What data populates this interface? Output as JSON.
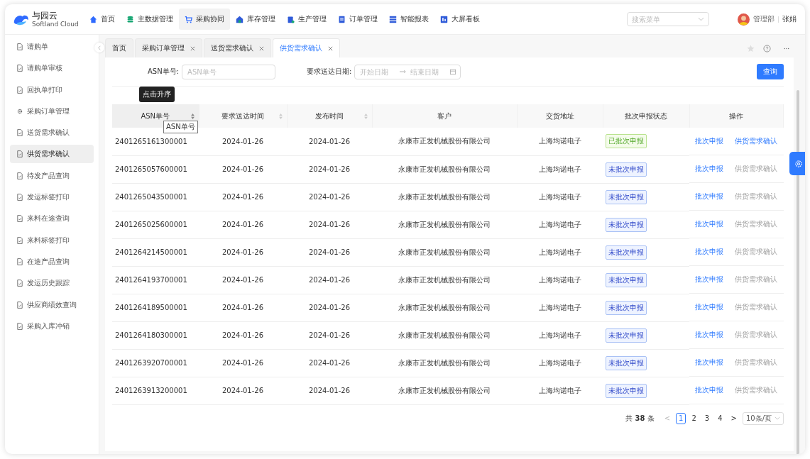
{
  "logo": {
    "name": "与园云",
    "subtitle": "Softland Cloud"
  },
  "nav": [
    {
      "label": "首页",
      "kind": "home",
      "selected": false
    },
    {
      "label": "主数据管理",
      "kind": "db",
      "selected": false
    },
    {
      "label": "采购协同",
      "kind": "cart",
      "selected": true
    },
    {
      "label": "库存管理",
      "kind": "store",
      "selected": false
    },
    {
      "label": "生产管理",
      "kind": "clip",
      "selected": false
    },
    {
      "label": "订单管理",
      "kind": "order",
      "selected": false
    },
    {
      "label": "智能报表",
      "kind": "list",
      "selected": false
    },
    {
      "label": "大屏看板",
      "kind": "board",
      "selected": false
    }
  ],
  "menu_search": {
    "placeholder": "搜索菜单"
  },
  "user": {
    "department": "管理部",
    "name": "张娟"
  },
  "sidebar": {
    "items": [
      {
        "label": "请购单",
        "kind": "doc",
        "selected": false
      },
      {
        "label": "请购单审核",
        "kind": "doc",
        "selected": false
      },
      {
        "label": "回执单打印",
        "kind": "doc",
        "selected": false
      },
      {
        "label": "采购订单管理",
        "kind": "gear",
        "selected": false
      },
      {
        "label": "送货需求确认",
        "kind": "doc",
        "selected": false
      },
      {
        "label": "供货需求确认",
        "kind": "doc",
        "selected": true
      },
      {
        "label": "待发产品查询",
        "kind": "doc",
        "selected": false
      },
      {
        "label": "发运标签打印",
        "kind": "doc",
        "selected": false
      },
      {
        "label": "来料在途查询",
        "kind": "doc",
        "selected": false
      },
      {
        "label": "来料标签打印",
        "kind": "doc",
        "selected": false
      },
      {
        "label": "在途产品查询",
        "kind": "doc",
        "selected": false
      },
      {
        "label": "发运历史跟踪",
        "kind": "doc",
        "selected": false
      },
      {
        "label": "供应商绩效查询",
        "kind": "doc",
        "selected": false
      },
      {
        "label": "采购入库冲销",
        "kind": "doc",
        "selected": false
      }
    ]
  },
  "tabs": [
    {
      "label": "首页",
      "closable": false,
      "selected": false
    },
    {
      "label": "采购订单管理",
      "closable": true,
      "selected": false
    },
    {
      "label": "送货需求确认",
      "closable": true,
      "selected": false
    },
    {
      "label": "供货需求确认",
      "closable": true,
      "selected": true
    }
  ],
  "filters": {
    "asn_label": "ASN单号:",
    "asn_placeholder": "ASN单号",
    "date_label": "要求送达日期:",
    "start_placeholder": "开始日期",
    "end_placeholder": "结束日期",
    "search_button": "查询"
  },
  "table": {
    "columns": [
      {
        "label": "ASN单号",
        "sortable": true
      },
      {
        "label": "要求送达时间",
        "sortable": true
      },
      {
        "label": "发布时间",
        "sortable": true
      },
      {
        "label": "客户",
        "sortable": false
      },
      {
        "label": "交货地址",
        "sortable": false
      },
      {
        "label": "批次申报状态",
        "sortable": false
      },
      {
        "label": "操作",
        "sortable": false
      }
    ],
    "sort_tooltip": "点击升序",
    "header_tooltip": "ASN单号",
    "rows": [
      {
        "asn": "2401265161300001",
        "required": "2024-01-26",
        "published": "2024-01-26",
        "customer": "永康市正发机械股份有限公司",
        "address": "上海均诺电子",
        "status": "已批次申报",
        "kind": "done",
        "action_1": "批次申报",
        "action_2": "供货需求确认",
        "action_2_disabled": false
      },
      {
        "asn": "2401265057600001",
        "required": "2024-01-26",
        "published": "2024-01-26",
        "customer": "永康市正发机械股份有限公司",
        "address": "上海均诺电子",
        "status": "未批次申报",
        "kind": "pending",
        "action_1": "批次申报",
        "action_2": "供货需求确认",
        "action_2_disabled": true
      },
      {
        "asn": "2401265043500001",
        "required": "2024-01-26",
        "published": "2024-01-26",
        "customer": "永康市正发机械股份有限公司",
        "address": "上海均诺电子",
        "status": "未批次申报",
        "kind": "pending",
        "action_1": "批次申报",
        "action_2": "供货需求确认",
        "action_2_disabled": true
      },
      {
        "asn": "2401265025600001",
        "required": "2024-01-26",
        "published": "2024-01-26",
        "customer": "永康市正发机械股份有限公司",
        "address": "上海均诺电子",
        "status": "未批次申报",
        "kind": "pending",
        "action_1": "批次申报",
        "action_2": "供货需求确认",
        "action_2_disabled": true
      },
      {
        "asn": "2401264214500001",
        "required": "2024-01-26",
        "published": "2024-01-26",
        "customer": "永康市正发机械股份有限公司",
        "address": "上海均诺电子",
        "status": "未批次申报",
        "kind": "pending",
        "action_1": "批次申报",
        "action_2": "供货需求确认",
        "action_2_disabled": true
      },
      {
        "asn": "2401264193700001",
        "required": "2024-01-26",
        "published": "2024-01-26",
        "customer": "永康市正发机械股份有限公司",
        "address": "上海均诺电子",
        "status": "未批次申报",
        "kind": "pending",
        "action_1": "批次申报",
        "action_2": "供货需求确认",
        "action_2_disabled": true
      },
      {
        "asn": "2401264189500001",
        "required": "2024-01-26",
        "published": "2024-01-26",
        "customer": "永康市正发机械股份有限公司",
        "address": "上海均诺电子",
        "status": "未批次申报",
        "kind": "pending",
        "action_1": "批次申报",
        "action_2": "供货需求确认",
        "action_2_disabled": true
      },
      {
        "asn": "2401264180300001",
        "required": "2024-01-26",
        "published": "2024-01-26",
        "customer": "永康市正发机械股份有限公司",
        "address": "上海均诺电子",
        "status": "未批次申报",
        "kind": "pending",
        "action_1": "批次申报",
        "action_2": "供货需求确认",
        "action_2_disabled": true
      },
      {
        "asn": "2401263920700001",
        "required": "2024-01-26",
        "published": "2024-01-26",
        "customer": "永康市正发机械股份有限公司",
        "address": "上海均诺电子",
        "status": "未批次申报",
        "kind": "pending",
        "action_1": "批次申报",
        "action_2": "供货需求确认",
        "action_2_disabled": true
      },
      {
        "asn": "2401263913200001",
        "required": "2024-01-26",
        "published": "2024-01-26",
        "customer": "永康市正发机械股份有限公司",
        "address": "上海均诺电子",
        "status": "未批次申报",
        "kind": "pending",
        "action_1": "批次申报",
        "action_2": "供货需求确认",
        "action_2_disabled": true
      }
    ]
  },
  "pagination": {
    "total": "共 **38** 条",
    "prev": "<",
    "pages": [
      {
        "label": "1",
        "selected": true
      },
      {
        "label": "2",
        "selected": false
      },
      {
        "label": "3",
        "selected": false
      },
      {
        "label": "4",
        "selected": false
      }
    ],
    "next": ">",
    "page_size": "10条/页"
  }
}
